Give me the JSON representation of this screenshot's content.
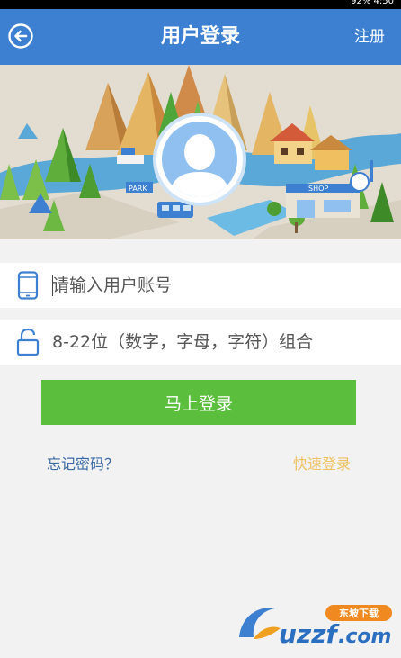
{
  "status_bar": {
    "text": "92%  4:50"
  },
  "header": {
    "title": "用户登录",
    "register_label": "注册"
  },
  "banner": {
    "shop_sign": "SHOP",
    "park_sign": "PARK"
  },
  "form": {
    "username_placeholder": "请输入用户账号",
    "password_placeholder": "8-22位（数字，字母，字符）组合",
    "login_label": "马上登录",
    "forgot_label": "忘记密码？",
    "quick_login_label": "快速登录"
  },
  "watermark": {
    "brand": "uzzf",
    "domain": ".com",
    "tag": "东坡下载"
  },
  "colors": {
    "header_bg": "#3d7fd0",
    "login_btn": "#5bbf3d",
    "forgot_text": "#3a6aa5",
    "quick_text": "#f0c060",
    "page_bg": "#f2f2f2"
  },
  "icons": {
    "back": "back-arrow-icon",
    "phone": "phone-icon",
    "lock": "lock-icon",
    "avatar": "user-avatar-icon"
  }
}
